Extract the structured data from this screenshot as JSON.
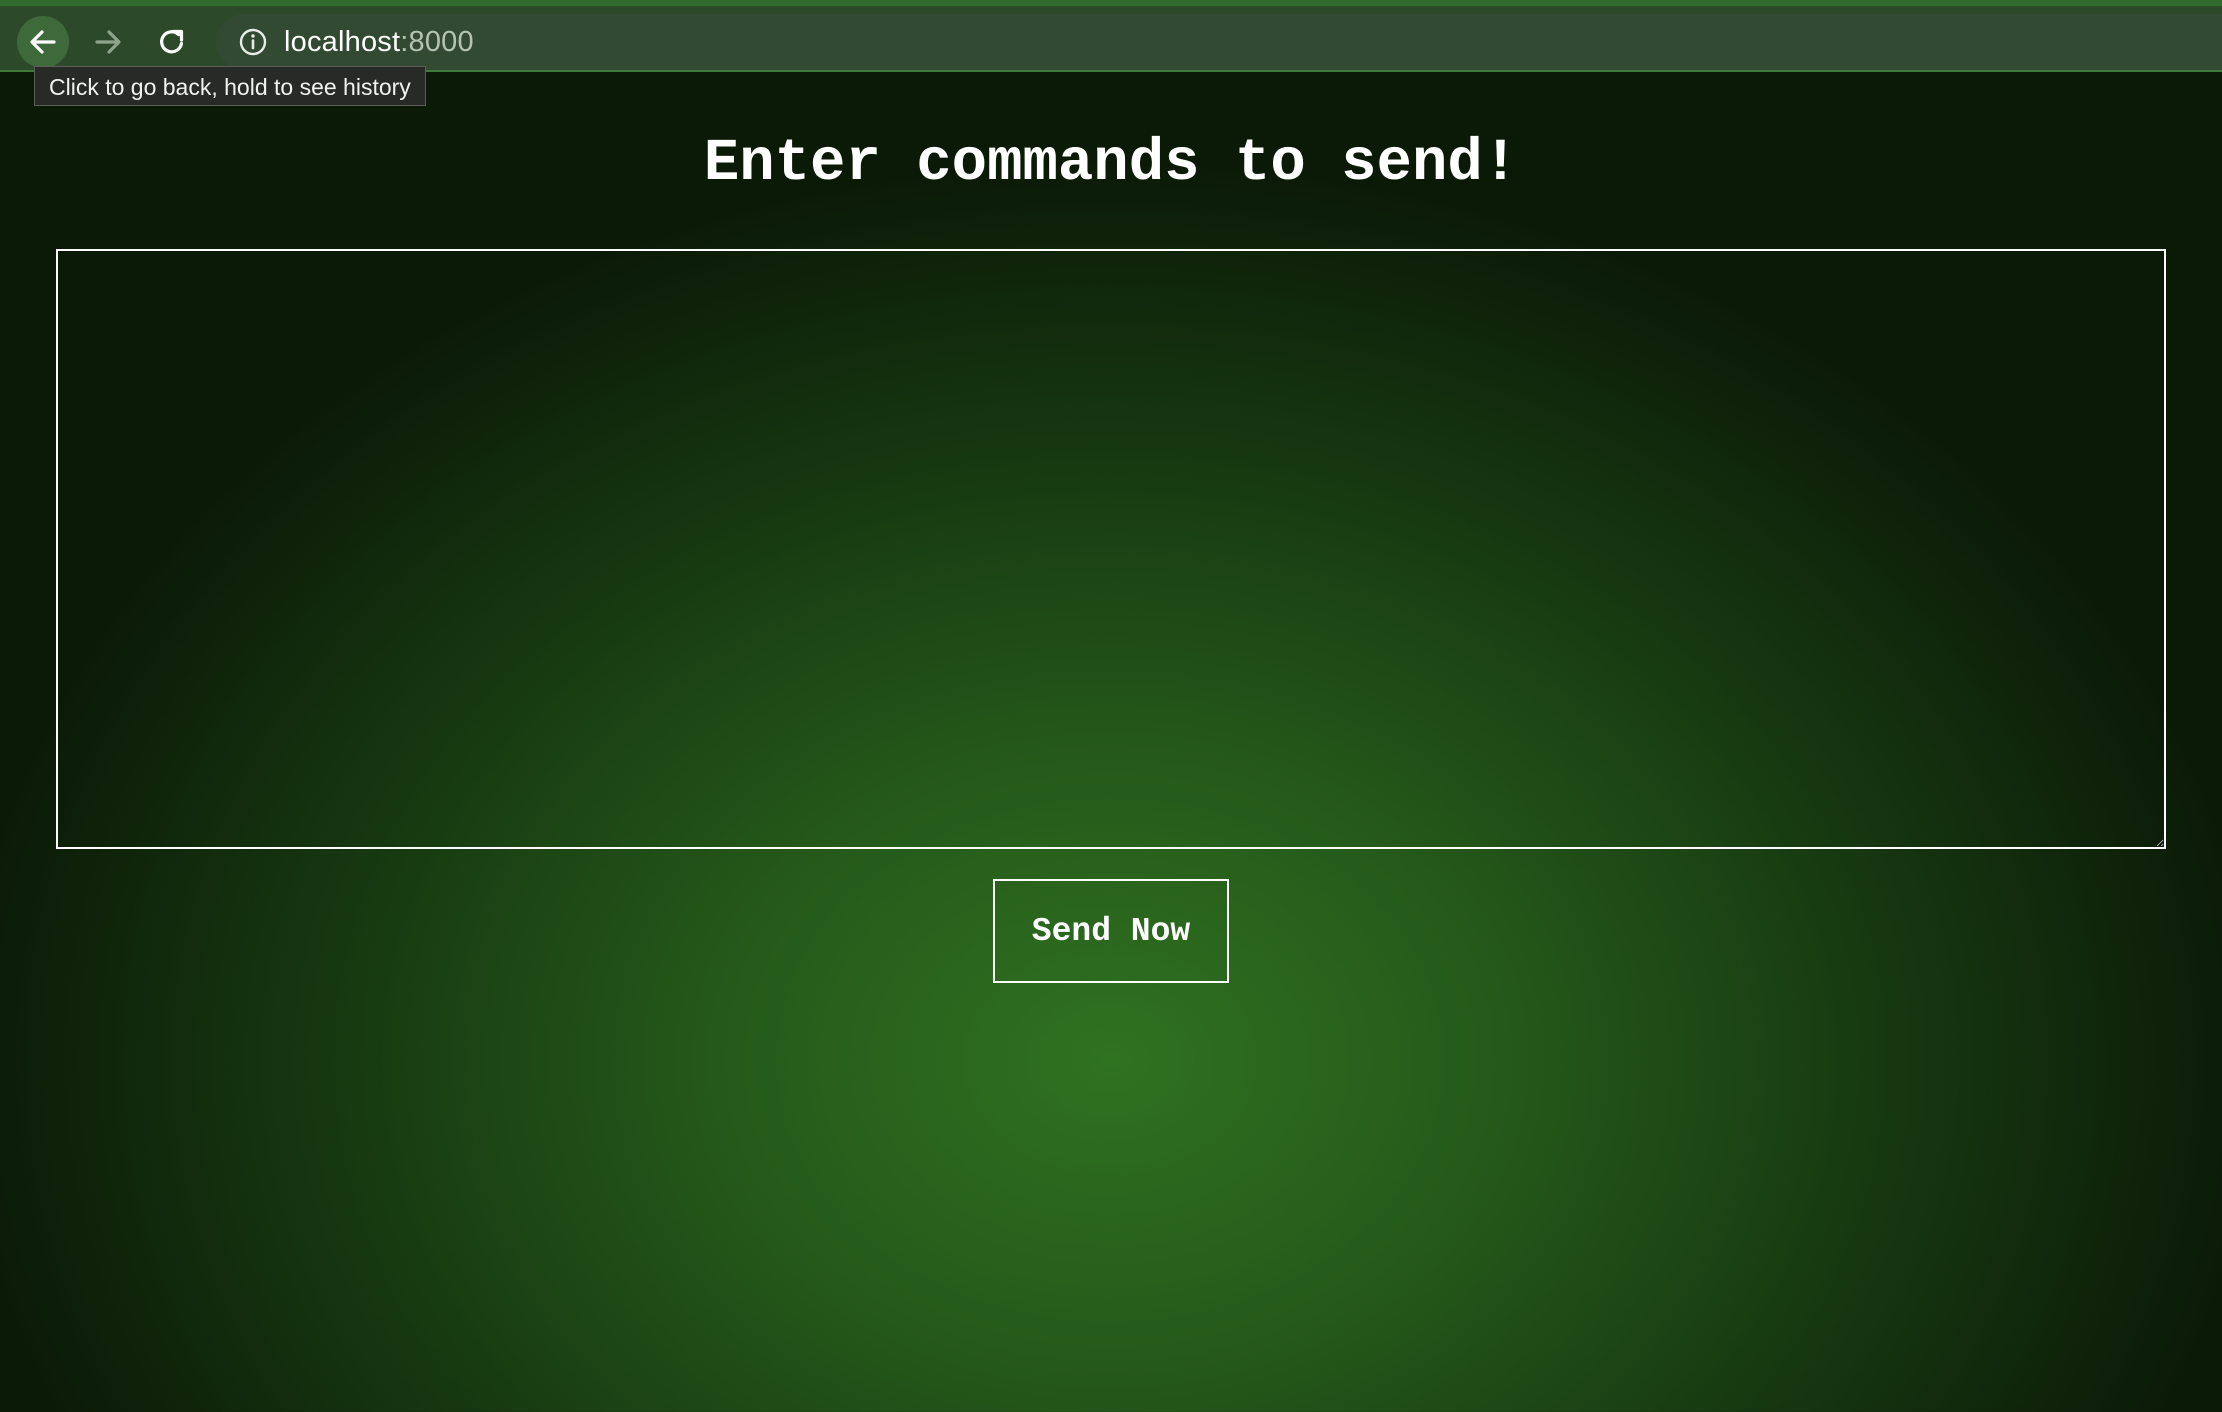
{
  "browser": {
    "url_host": "localhost",
    "url_port": ":8000",
    "back_tooltip": "Click to go back, hold to see history",
    "icons": {
      "back": "arrow-left-icon",
      "forward": "arrow-right-icon",
      "reload": "reload-icon",
      "site_info": "info-icon"
    }
  },
  "page": {
    "title": "Enter commands to send!",
    "command_input_value": "",
    "send_button_label": "Send Now"
  },
  "colors": {
    "background_center": "#2f7220",
    "background_edge": "#0b1a07",
    "toolbar": "#2c4a2a",
    "text": "#ffffff"
  }
}
